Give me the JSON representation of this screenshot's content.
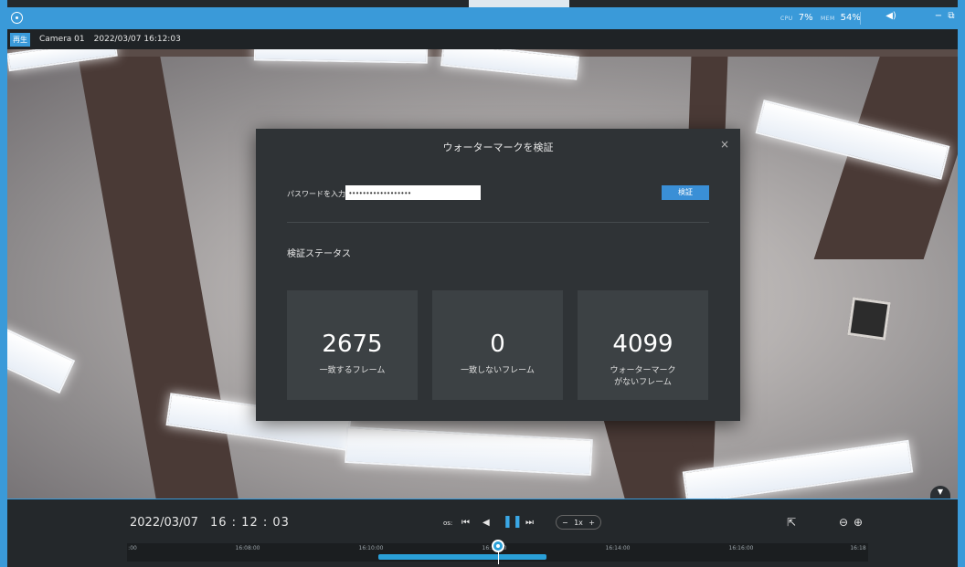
{
  "titlebar": {
    "cpu_label": "CPU",
    "cpu_value": "7%",
    "mem_label": "MEM",
    "mem_value": "54%",
    "volume_icon": "speaker-icon",
    "minimize": "−",
    "restore": "⧉"
  },
  "video": {
    "mode_tag": "再生",
    "camera_name": "Camera 01",
    "timestamp": "2022/03/07 16:12:03",
    "collapse_icon": "▼"
  },
  "dialog": {
    "title": "ウォーターマークを検証",
    "close": "×",
    "password_label": "パスワードを入力",
    "password_value": "••••••••••••••••••",
    "verify_button": "検証",
    "status_title": "検証ステータス",
    "cards": [
      {
        "value": "2675",
        "label": "一致するフレーム"
      },
      {
        "value": "0",
        "label": "一致しないフレーム"
      },
      {
        "value": "4099",
        "label_line1": "ウォーターマーク",
        "label_line2": "がないフレーム"
      }
    ]
  },
  "playback": {
    "date": "2022/03/07",
    "time": "16 : 12 : 03",
    "step_label": "os:",
    "prev_icon": "skip-back-icon",
    "reverse_icon": "play-reverse-icon",
    "pause_icon": "pause-icon",
    "next_icon": "skip-forward-icon",
    "speed_minus": "−",
    "speed_value": "1x",
    "speed_plus": "+",
    "export_icon": "export-icon",
    "zoom_out": "⊖",
    "zoom_in": "⊕"
  },
  "timeline": {
    "ticks": [
      ":00",
      "16:08:00",
      "16:10:00",
      "16:12:00",
      "16:14:00",
      "16:16:00",
      "16:18"
    ]
  },
  "colors": {
    "accent": "#3a9ad9",
    "panel": "#2f3336",
    "card": "#3c4144"
  }
}
